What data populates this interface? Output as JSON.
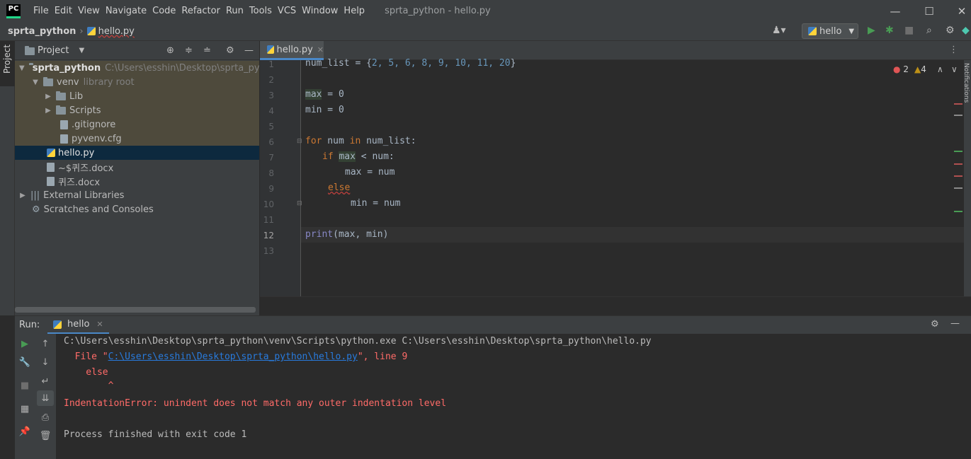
{
  "window": {
    "title": "sprta_python - hello.py",
    "logo_text": "PC",
    "controls": [
      "—",
      "☐",
      "✕"
    ]
  },
  "menu": [
    "File",
    "Edit",
    "View",
    "Navigate",
    "Code",
    "Refactor",
    "Run",
    "Tools",
    "VCS",
    "Window",
    "Help"
  ],
  "breadcrumb": {
    "project": "sprta_python",
    "file": "hello.py"
  },
  "toolbar": {
    "run_config": "hello"
  },
  "project_panel": {
    "title": "Project",
    "stripe_label": "Project",
    "root_name": "sprta_python",
    "root_path": "C:\\Users\\esshin\\Desktop\\sprta_python",
    "venv_name": "venv",
    "venv_note": "library root",
    "lib": "Lib",
    "scripts": "Scripts",
    "gitignore": ".gitignore",
    "pyvenv": "pyvenv.cfg",
    "hello": "hello.py",
    "tmpdoc": "~$퀴즈.docx",
    "quizdoc": "퀴즈.docx",
    "ext_libs": "External Libraries",
    "scratches": "Scratches and Consoles"
  },
  "editor": {
    "tab_label": "hello.py",
    "errors": "2",
    "warnings": "4",
    "line_numbers": [
      "1",
      "2",
      "3",
      "4",
      "5",
      "6",
      "7",
      "8",
      "9",
      "10",
      "11",
      "12",
      "13"
    ],
    "code": {
      "l1_a": "num_list = {",
      "l1_nums": "2, 5, 6, 8, 9, 10, 11, 20",
      "l1_b": "}",
      "l3_var": "max",
      "l3_rest": " = 0",
      "l4_var": "min",
      "l4_rest": " = 0",
      "l6_for": "for",
      "l6_mid": " num ",
      "l6_in": "in",
      "l6_rest": " num_list:",
      "l7_if": "if",
      "l7_var": "max",
      "l7_rest": " < num:",
      "l8": "max = num",
      "l9": "else",
      "l10": "min = num",
      "l12_fn": "print",
      "l12_rest": "(max, min)"
    },
    "notifications_label": "Notifications"
  },
  "run_panel": {
    "label": "Run:",
    "tab": "hello",
    "output": {
      "cmd": "C:\\Users\\esshin\\Desktop\\sprta_python\\venv\\Scripts\\python.exe C:\\Users\\esshin\\Desktop\\sprta_python\\hello.py",
      "file_prefix": "  File \"",
      "file_link": "C:\\Users\\esshin\\Desktop\\sprta_python\\hello.py",
      "file_suffix": "\", line 9",
      "else_line": "    else",
      "caret_line": "        ^",
      "error": "IndentationError: unindent does not match any outer indentation level",
      "finished": "Process finished with exit code 1"
    }
  },
  "colors": {
    "accent": "#4a88c7",
    "error": "#ff6b68",
    "run_green": "#499c54",
    "keyword": "#cc7832",
    "number": "#6897bb"
  }
}
